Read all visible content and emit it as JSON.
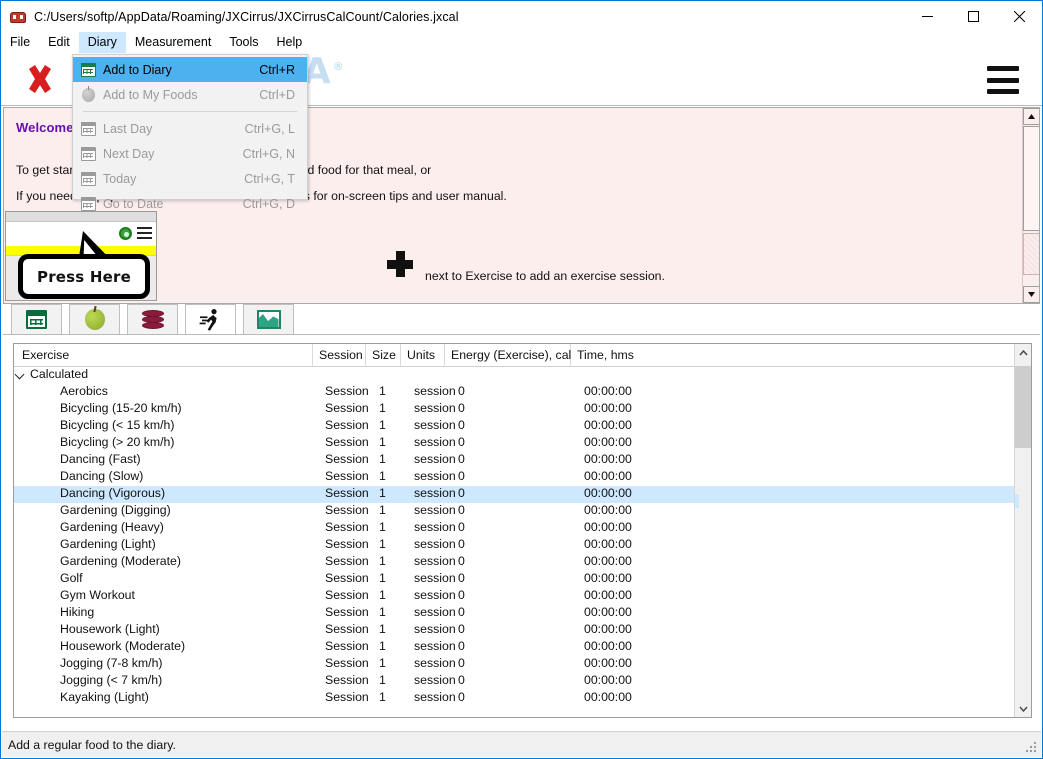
{
  "window": {
    "title": "C:/Users/softp/AppData/Roaming/JXCirrus/JXCirrusCalCount/Calories.jxcal",
    "app_icon": "bug-icon",
    "minimize_label": "Minimize",
    "maximize_label": "Maximize",
    "close_label": "Close"
  },
  "menubar": {
    "items": [
      {
        "label": "File",
        "open": false
      },
      {
        "label": "Edit",
        "open": false
      },
      {
        "label": "Diary",
        "open": true
      },
      {
        "label": "Measurement",
        "open": false
      },
      {
        "label": "Tools",
        "open": false
      },
      {
        "label": "Help",
        "open": false
      }
    ]
  },
  "dropdown": {
    "name": "diary-menu",
    "items": [
      {
        "label": "Add to Diary",
        "shortcut": "Ctrl+R",
        "icon": "calendar-add-icon",
        "state": "highlighted"
      },
      {
        "label": "Add to My Foods",
        "shortcut": "Ctrl+D",
        "icon": "apple-icon",
        "state": "disabled"
      },
      {
        "separator": true
      },
      {
        "label": "Last Day",
        "shortcut": "Ctrl+G, L",
        "icon": "calendar-prev-icon",
        "state": "disabled"
      },
      {
        "label": "Next Day",
        "shortcut": "Ctrl+G, N",
        "icon": "calendar-next-icon",
        "state": "disabled"
      },
      {
        "label": "Today",
        "shortcut": "Ctrl+G, T",
        "icon": "calendar-today-icon",
        "state": "disabled"
      },
      {
        "label": "Go to Date",
        "shortcut": "Ctrl+G, D",
        "icon": "calendar-goto-icon",
        "state": "disabled"
      }
    ]
  },
  "watermark": {
    "text": "SOFTPEDIA",
    "mark": "®"
  },
  "toolbar": {
    "delete_icon": "red-x-delete-icon",
    "barcode_icon": "barcode-icon",
    "search_value": "",
    "search_placeholder": "",
    "search_icon": "magnifier-icon",
    "menu_icon": "hamburger-menu-icon"
  },
  "welcome": {
    "title": "Welcome to JXCirrus Calories",
    "line1": "To get started, press the + button next to a meal to add food for that meal, or",
    "line1_after_plus": "next to Exercise to add an exercise session.",
    "line2": "If you need help, press the ? or the three lines buttons for on-screen tips and user manual.",
    "plus_icon": "plus-icon",
    "background_color": "#fdeeee",
    "title_color": "#6a0dad"
  },
  "press_here": {
    "label": "Press Here",
    "green_icon": "green-status-icon",
    "menu_icon": "hamburger-menu-icon",
    "highlight_color": "#ffff00"
  },
  "tabs": [
    {
      "name": "tab-diary",
      "icon": "calendar-icon",
      "active": false
    },
    {
      "name": "tab-foods",
      "icon": "apple-icon",
      "active": false
    },
    {
      "name": "tab-database",
      "icon": "database-icon",
      "active": false
    },
    {
      "name": "tab-exercise",
      "icon": "running-person-icon",
      "active": true
    },
    {
      "name": "tab-charts",
      "icon": "chart-icon",
      "active": false
    }
  ],
  "table": {
    "columns": [
      "Exercise",
      "Session",
      "Size",
      "Units",
      "Energy (Exercise), cal",
      "Time, hms"
    ],
    "group": {
      "label": "Calculated",
      "expanded": true,
      "chevron": "chevron-down-icon"
    },
    "rows": [
      {
        "exercise": "Aerobics",
        "session": "Session",
        "size": "1",
        "units": "session",
        "energy": "0",
        "time": "00:00:00",
        "selected": false
      },
      {
        "exercise": "Bicycling (15-20 km/h)",
        "session": "Session",
        "size": "1",
        "units": "session",
        "energy": "0",
        "time": "00:00:00",
        "selected": false
      },
      {
        "exercise": "Bicycling (< 15 km/h)",
        "session": "Session",
        "size": "1",
        "units": "session",
        "energy": "0",
        "time": "00:00:00",
        "selected": false
      },
      {
        "exercise": "Bicycling (> 20 km/h)",
        "session": "Session",
        "size": "1",
        "units": "session",
        "energy": "0",
        "time": "00:00:00",
        "selected": false
      },
      {
        "exercise": "Dancing (Fast)",
        "session": "Session",
        "size": "1",
        "units": "session",
        "energy": "0",
        "time": "00:00:00",
        "selected": false
      },
      {
        "exercise": "Dancing (Slow)",
        "session": "Session",
        "size": "1",
        "units": "session",
        "energy": "0",
        "time": "00:00:00",
        "selected": false
      },
      {
        "exercise": "Dancing (Vigorous)",
        "session": "Session",
        "size": "1",
        "units": "session",
        "energy": "0",
        "time": "00:00:00",
        "selected": true
      },
      {
        "exercise": "Gardening (Digging)",
        "session": "Session",
        "size": "1",
        "units": "session",
        "energy": "0",
        "time": "00:00:00",
        "selected": false
      },
      {
        "exercise": "Gardening (Heavy)",
        "session": "Session",
        "size": "1",
        "units": "session",
        "energy": "0",
        "time": "00:00:00",
        "selected": false
      },
      {
        "exercise": "Gardening (Light)",
        "session": "Session",
        "size": "1",
        "units": "session",
        "energy": "0",
        "time": "00:00:00",
        "selected": false
      },
      {
        "exercise": "Gardening (Moderate)",
        "session": "Session",
        "size": "1",
        "units": "session",
        "energy": "0",
        "time": "00:00:00",
        "selected": false
      },
      {
        "exercise": "Golf",
        "session": "Session",
        "size": "1",
        "units": "session",
        "energy": "0",
        "time": "00:00:00",
        "selected": false
      },
      {
        "exercise": "Gym Workout",
        "session": "Session",
        "size": "1",
        "units": "session",
        "energy": "0",
        "time": "00:00:00",
        "selected": false
      },
      {
        "exercise": "Hiking",
        "session": "Session",
        "size": "1",
        "units": "session",
        "energy": "0",
        "time": "00:00:00",
        "selected": false
      },
      {
        "exercise": "Housework (Light)",
        "session": "Session",
        "size": "1",
        "units": "session",
        "energy": "0",
        "time": "00:00:00",
        "selected": false
      },
      {
        "exercise": "Housework (Moderate)",
        "session": "Session",
        "size": "1",
        "units": "session",
        "energy": "0",
        "time": "00:00:00",
        "selected": false
      },
      {
        "exercise": "Jogging (7-8 km/h)",
        "session": "Session",
        "size": "1",
        "units": "session",
        "energy": "0",
        "time": "00:00:00",
        "selected": false
      },
      {
        "exercise": "Jogging (< 7 km/h)",
        "session": "Session",
        "size": "1",
        "units": "session",
        "energy": "0",
        "time": "00:00:00",
        "selected": false
      },
      {
        "exercise": "Kayaking (Light)",
        "session": "Session",
        "size": "1",
        "units": "session",
        "energy": "0",
        "time": "00:00:00",
        "selected": false
      }
    ]
  },
  "statusbar": {
    "text": "Add a regular food to the diary."
  }
}
